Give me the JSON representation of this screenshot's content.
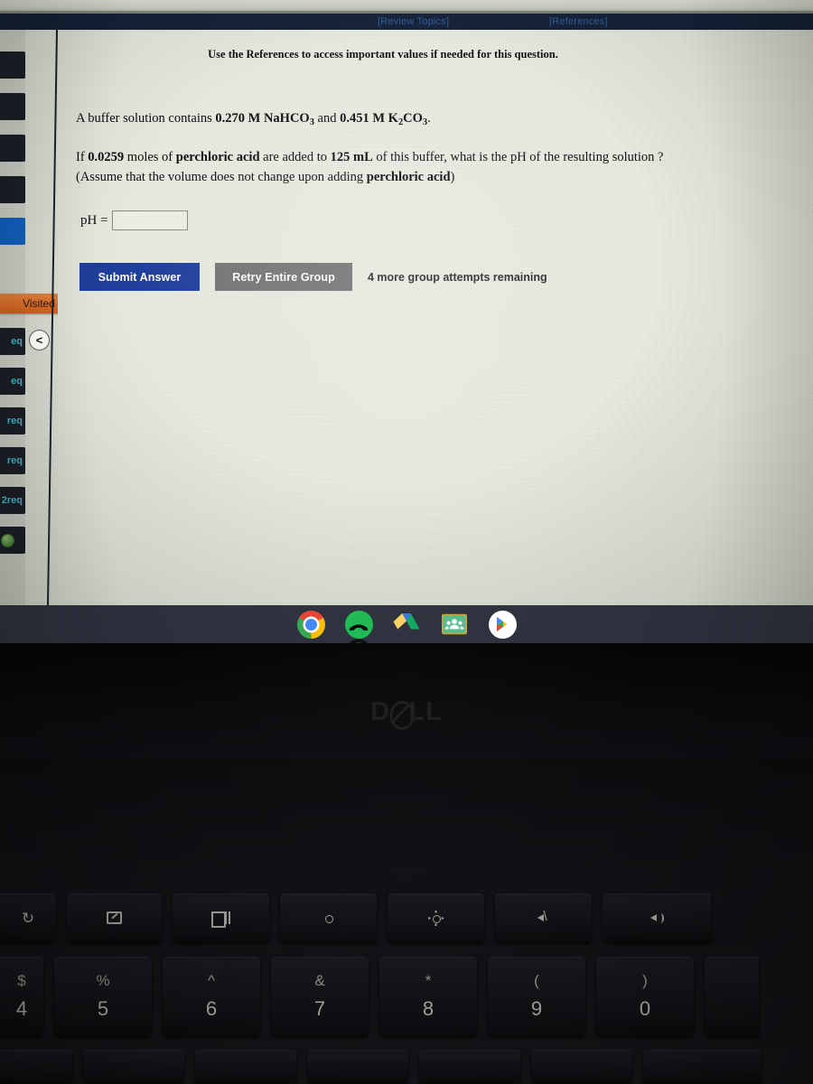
{
  "header": {
    "review_topics_link": "[Review Topics]",
    "references_link": "[References]",
    "bar_color": "#132038",
    "link_color": "#2f5e9e"
  },
  "content": {
    "reference_note": "Use the References to access important values if needed for this question.",
    "question_line_1_a": "A buffer solution contains ",
    "question_line_1_conc1": "0.270 M NaHCO",
    "question_line_1_sub1": "3",
    "question_line_1_b": " and ",
    "question_line_1_conc2": "0.451 M K",
    "question_line_1_sub2": "2",
    "question_line_1_conc3": "CO",
    "question_line_1_sub3": "3",
    "question_line_1_end": ".",
    "question_line_2_a": "If ",
    "question_line_2_moles": "0.0259",
    "question_line_2_b": " moles of ",
    "question_line_2_acid": "perchloric acid",
    "question_line_2_c": " are added to ",
    "question_line_2_volume": "125 mL",
    "question_line_2_d": " of this buffer, what is the pH of the resulting solution ?",
    "question_line_3_a": "(Assume that the volume does not change upon adding ",
    "question_line_3_acid": "perchloric acid",
    "question_line_3_b": ")"
  },
  "answer": {
    "label": "pH =",
    "value": "",
    "placeholder": ""
  },
  "buttons": {
    "submit_label": "Submit Answer",
    "submit_color": "#1f3f9e",
    "retry_label": "Retry Entire Group",
    "retry_color": "#757575",
    "attempts_text": "4 more group attempts remaining"
  },
  "sidebar": {
    "visited_badge": "Visited",
    "visited_color": "#e3621f",
    "collapse_icon": "<",
    "items": [
      {
        "label": "",
        "selected": false
      },
      {
        "label": "",
        "selected": false
      },
      {
        "label": "",
        "selected": false
      },
      {
        "label": "",
        "selected": false
      },
      {
        "label": "",
        "selected": true
      },
      {
        "label": "eq",
        "selected": false
      },
      {
        "label": "eq",
        "selected": false
      },
      {
        "label": "req",
        "selected": false
      },
      {
        "label": "req",
        "selected": false
      },
      {
        "label": "2req",
        "selected": false
      },
      {
        "label": "",
        "selected": false
      }
    ]
  },
  "shelf": {
    "background": "#2b303c",
    "icons": [
      {
        "name": "chrome-icon",
        "label": "Chrome"
      },
      {
        "name": "spotify-icon",
        "label": "Spotify"
      },
      {
        "name": "google-drive-icon",
        "label": "Google Drive"
      },
      {
        "name": "google-classroom-icon",
        "label": "Google Classroom"
      },
      {
        "name": "google-play-icon",
        "label": "Google Play Store"
      }
    ]
  },
  "laptop": {
    "brand": "D",
    "brand_rest": "LL"
  },
  "keyboard": {
    "function_row": [
      {
        "glyph": "refresh",
        "name": "refresh-key"
      },
      {
        "glyph": "fullscreen",
        "name": "fullscreen-key"
      },
      {
        "glyph": "overview",
        "name": "window-overview-key"
      },
      {
        "glyph": "brightness-down",
        "name": "brightness-down-key"
      },
      {
        "glyph": "brightness-up",
        "name": "brightness-up-key"
      },
      {
        "glyph": "mute",
        "name": "mute-key"
      },
      {
        "glyph": "volume",
        "name": "volume-key"
      }
    ],
    "number_row": [
      {
        "top": "$",
        "num": "4"
      },
      {
        "top": "%",
        "num": "5"
      },
      {
        "top": "^",
        "num": "6"
      },
      {
        "top": "&",
        "num": "7"
      },
      {
        "top": "*",
        "num": "8"
      },
      {
        "top": "(",
        "num": "9"
      },
      {
        "top": ")",
        "num": "0"
      }
    ]
  }
}
